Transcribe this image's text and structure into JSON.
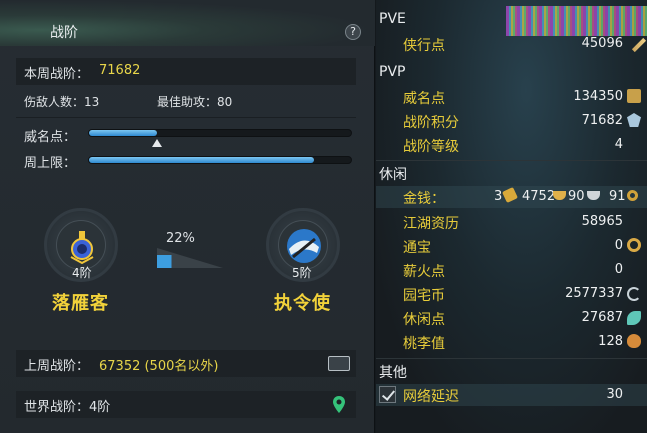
{
  "left": {
    "title": "战阶",
    "help": "?",
    "weekly_label": "本周战阶：",
    "weekly_value": "71682",
    "kills_label": "伤敌人数：13",
    "assist_label": "最佳助攻：80",
    "fame_label": "威名点：",
    "limit_label": "周上限：",
    "fame_progress": 0.26,
    "limit_progress": 0.86,
    "percent": "22%",
    "percent_value": 0.22,
    "current_tier": "4阶",
    "current_name": "落雁客",
    "next_tier": "5阶",
    "next_name": "执令使",
    "last_week_label": "上周战阶：",
    "last_week_value": "67352 (500名以外)",
    "world_label": "世界战阶：4阶"
  },
  "right": {
    "pve": "PVE",
    "xiaxing_label": "侠行点",
    "xiaxing_value": "45096",
    "pvp": "PVP",
    "weiming_label": "威名点",
    "weiming_value": "134350",
    "zhanjie_score_label": "战阶积分",
    "zhanjie_score_value": "71682",
    "zhanjie_level_label": "战阶等级",
    "zhanjie_level_value": "4",
    "leisure": "休闲",
    "money_label": "金钱：",
    "money_gold": "3",
    "money_ingot": "4752",
    "money_silver": "90",
    "money_copper": "91",
    "jianghu_label": "江湖资历",
    "jianghu_value": "58965",
    "tongbao_label": "通宝",
    "tongbao_value": "0",
    "xinhuo_label": "薪火点",
    "xinhuo_value": "0",
    "yuanzhai_label": "园宅币",
    "yuanzhai_value": "2577337",
    "xiuxian_label": "休闲点",
    "xiuxian_value": "27687",
    "taoli_label": "桃李值",
    "taoli_value": "128",
    "other": "其他",
    "latency_label": "网络延迟",
    "latency_value": "30"
  },
  "colors": {
    "accent_yellow": "#e8d64a",
    "bar_blue": "#2f89cf",
    "label_gold": "#e7cc3a"
  }
}
